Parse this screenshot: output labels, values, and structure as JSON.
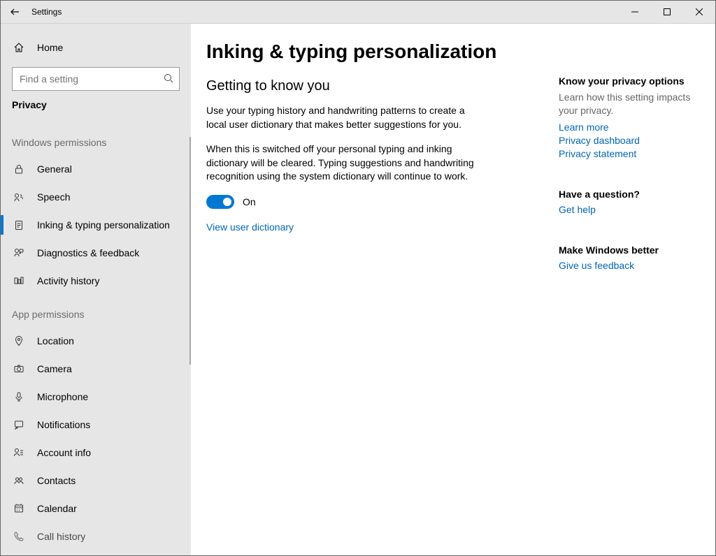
{
  "window": {
    "app_title": "Settings"
  },
  "sidebar": {
    "home_label": "Home",
    "search_placeholder": "Find a setting",
    "category_label": "Privacy",
    "group1_header": "Windows permissions",
    "group1_items": [
      {
        "id": "general",
        "label": "General"
      },
      {
        "id": "speech",
        "label": "Speech"
      },
      {
        "id": "inking",
        "label": "Inking & typing personalization"
      },
      {
        "id": "diagnostics",
        "label": "Diagnostics & feedback"
      },
      {
        "id": "activity",
        "label": "Activity history"
      }
    ],
    "group2_header": "App permissions",
    "group2_items": [
      {
        "id": "location",
        "label": "Location"
      },
      {
        "id": "camera",
        "label": "Camera"
      },
      {
        "id": "microphone",
        "label": "Microphone"
      },
      {
        "id": "notifications",
        "label": "Notifications"
      },
      {
        "id": "account",
        "label": "Account info"
      },
      {
        "id": "contacts",
        "label": "Contacts"
      },
      {
        "id": "calendar",
        "label": "Calendar"
      },
      {
        "id": "callhistory",
        "label": "Call history"
      }
    ]
  },
  "main": {
    "page_title": "Inking & typing personalization",
    "sub_title": "Getting to know you",
    "para1": "Use your typing history and handwriting patterns to create a local user dictionary that makes better suggestions for you.",
    "para2": "When this is switched off your personal typing and inking dictionary will be cleared. Typing suggestions and handwriting recognition using the system dictionary will continue to work.",
    "toggle_state_label": "On",
    "view_dict_link": "View user dictionary"
  },
  "aside": {
    "privacy_heading": "Know your privacy options",
    "privacy_desc": "Learn how this setting impacts your privacy.",
    "learn_more": "Learn more",
    "privacy_dashboard": "Privacy dashboard",
    "privacy_statement": "Privacy statement",
    "question_heading": "Have a question?",
    "get_help": "Get help",
    "better_heading": "Make Windows better",
    "feedback": "Give us feedback"
  }
}
